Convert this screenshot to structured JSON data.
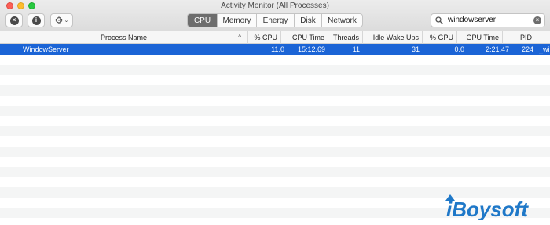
{
  "window": {
    "title": "Activity Monitor (All Processes)"
  },
  "toolbar": {
    "stop_icon": "x-circle-icon",
    "info_icon": "info-circle-icon",
    "gear_icon": "gear-icon",
    "tabs": [
      {
        "label": "CPU",
        "active": true
      },
      {
        "label": "Memory",
        "active": false
      },
      {
        "label": "Energy",
        "active": false
      },
      {
        "label": "Disk",
        "active": false
      },
      {
        "label": "Network",
        "active": false
      }
    ],
    "search": {
      "value": "windowserver",
      "icon": "search-icon",
      "clear_icon": "clear-icon"
    }
  },
  "table": {
    "columns": [
      "Process Name",
      "% CPU",
      "CPU Time",
      "Threads",
      "Idle Wake Ups",
      "% GPU",
      "GPU Time",
      "PID"
    ],
    "sort_indicator": "^",
    "rows": [
      {
        "name": "WindowServer",
        "cpu": "11.0",
        "cpu_time": "15:12.69",
        "threads": "11",
        "idle_wake_ups": "31",
        "gpu": "0.0",
        "gpu_time": "2:21.47",
        "pid": "224",
        "user": "_wi",
        "selected": true
      }
    ]
  },
  "colors": {
    "selection": "#1b64d6",
    "active_tab": "#6d6d6d",
    "stripe": "#f4f5f5"
  },
  "watermark": {
    "text": "iBoysoft"
  }
}
